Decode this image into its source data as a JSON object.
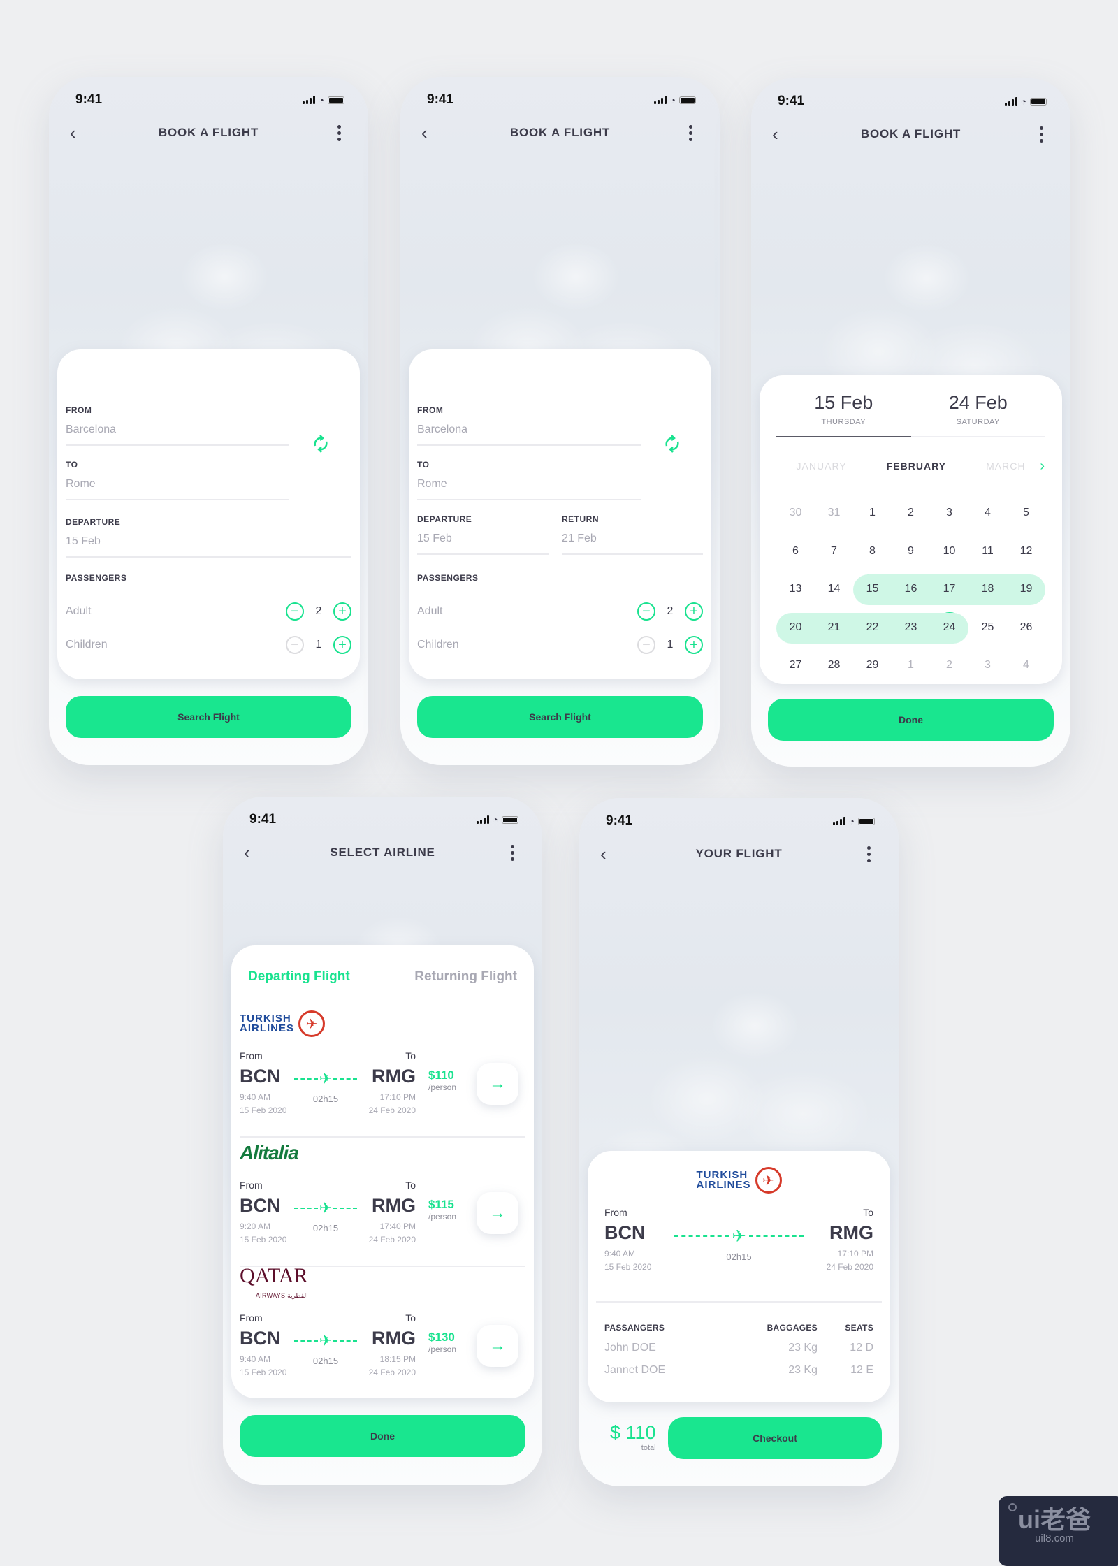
{
  "status": {
    "time": "9:41"
  },
  "colors": {
    "accent": "#19e28f",
    "button": "#19e68f",
    "range": "#cff7e6",
    "text": "#3c3b4a",
    "muted": "#a8a8b3"
  },
  "icons": {
    "back": "chevron-left-icon",
    "more": "more-vertical-icon",
    "swap": "swap-refresh-icon",
    "minus": "minus-circle-icon",
    "plus": "plus-circle-icon",
    "plane": "airplane-icon",
    "arrow": "arrow-right-icon",
    "next_month": "chevron-right-icon"
  },
  "screen1": {
    "title": "BOOK A FLIGHT",
    "from_label": "FROM",
    "from_value": "Barcelona",
    "to_label": "TO",
    "to_value": "Rome",
    "departure_label": "DEPARTURE",
    "departure_value": "15 Feb",
    "passengers_label": "PASSENGERS",
    "adult_label": "Adult",
    "adult_count": "2",
    "children_label": "Children",
    "children_count": "1",
    "button": "Search Flight"
  },
  "screen2": {
    "title": "BOOK A FLIGHT",
    "from_label": "FROM",
    "from_value": "Barcelona",
    "to_label": "TO",
    "to_value": "Rome",
    "departure_label": "DEPARTURE",
    "departure_value": "15 Feb",
    "return_label": "RETURN",
    "return_value": "21 Feb",
    "passengers_label": "PASSENGERS",
    "adult_label": "Adult",
    "adult_count": "2",
    "children_label": "Children",
    "children_count": "1",
    "button": "Search Flight"
  },
  "screen3": {
    "title": "BOOK A FLIGHT",
    "start_date": "15 Feb",
    "start_day": "THURSDAY",
    "end_date": "24 Feb",
    "end_day": "SATURDAY",
    "months": [
      "JANUARY",
      "FEBRUARY",
      "MARCH"
    ],
    "current_month": "FEBRUARY",
    "weeks": [
      [
        "30",
        "31",
        "1",
        "2",
        "3",
        "4",
        "5"
      ],
      [
        "6",
        "7",
        "8",
        "9",
        "10",
        "11",
        "12"
      ],
      [
        "13",
        "14",
        "15",
        "16",
        "17",
        "18",
        "19"
      ],
      [
        "20",
        "21",
        "22",
        "23",
        "24",
        "25",
        "26"
      ],
      [
        "27",
        "28",
        "29",
        "1",
        "2",
        "3",
        "4"
      ]
    ],
    "selected_start": "15",
    "selected_end": "24",
    "button": "Done"
  },
  "screen4": {
    "title": "SELECT AIRLINE",
    "tabs": [
      "Departing Flight",
      "Returning Flight"
    ],
    "active_tab": "Departing Flight",
    "flights": [
      {
        "airline": "Turkish Airlines",
        "logo_line1": "TURKISH",
        "logo_line2": "AIRLINES",
        "from_label": "From",
        "to_label": "To",
        "from_code": "BCN",
        "to_code": "RMG",
        "dep_time": "9:40 AM",
        "dep_date": "15 Feb 2020",
        "arr_time": "17:10 PM",
        "arr_date": "24 Feb 2020",
        "duration": "02h15",
        "price": "$110",
        "per": "/person"
      },
      {
        "airline": "Alitalia",
        "logo_line1": "Alitalia",
        "from_label": "From",
        "to_label": "To",
        "from_code": "BCN",
        "to_code": "RMG",
        "dep_time": "9:20 AM",
        "dep_date": "15 Feb 2020",
        "arr_time": "17:40 PM",
        "arr_date": "24 Feb 2020",
        "duration": "02h15",
        "price": "$115",
        "per": "/person"
      },
      {
        "airline": "Qatar Airways",
        "logo_line1": "QATAR",
        "logo_line2": "AIRWAYS القطرية",
        "from_label": "From",
        "to_label": "To",
        "from_code": "BCN",
        "to_code": "RMG",
        "dep_time": "9:40 AM",
        "dep_date": "15 Feb 2020",
        "arr_time": "18:15 PM",
        "arr_date": "24 Feb 2020",
        "duration": "02h15",
        "price": "$130",
        "per": "/person"
      }
    ],
    "button": "Done"
  },
  "screen5": {
    "title": "YOUR FLIGHT",
    "logo_line1": "TURKISH",
    "logo_line2": "AIRLINES",
    "from_label": "From",
    "to_label": "To",
    "from_code": "BCN",
    "to_code": "RMG",
    "dep_time": "9:40 AM",
    "dep_date": "15 Feb 2020",
    "arr_time": "17:10 PM",
    "arr_date": "24 Feb 2020",
    "duration": "02h15",
    "headers": [
      "PASSANGERS",
      "BAGGAGES",
      "SEATS"
    ],
    "passengers": [
      {
        "name": "John DOE",
        "baggage": "23 Kg",
        "seat": "12 D"
      },
      {
        "name": "Jannet DOE",
        "baggage": "23 Kg",
        "seat": "12 E"
      }
    ],
    "total_amount": "$ 110",
    "total_label": "total",
    "button": "Checkout"
  },
  "watermark": {
    "line1": "ui老爸",
    "line2": "uil8.com"
  }
}
